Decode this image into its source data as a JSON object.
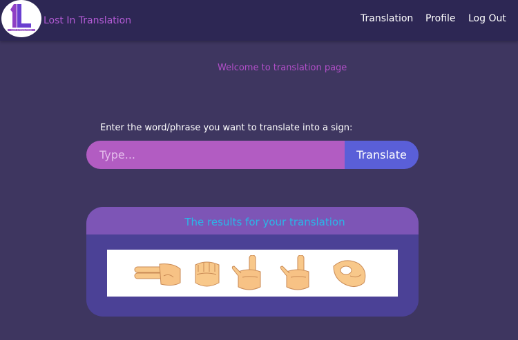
{
  "navbar": {
    "logo_alt": "LOST IN TRANSLATION",
    "title": "Lost In Translation",
    "links": [
      "Translation",
      "Profile",
      "Log Out"
    ]
  },
  "welcome": "Welcome to translation page",
  "input": {
    "label": "Enter the word/phrase you want to translate into a sign:",
    "placeholder": "Type...",
    "value": "",
    "button": "Translate"
  },
  "results": {
    "title": "The results for your translation",
    "signs": [
      "hand-sign-h-icon",
      "hand-sign-e-icon",
      "hand-sign-l-icon",
      "hand-sign-l-icon",
      "hand-sign-o-icon"
    ]
  },
  "colors": {
    "background": "#3e3660",
    "navbar": "#2d2754",
    "accent_purple": "#b25cc2",
    "button_blue": "#5a5fd8",
    "results_title": "#29b7e8"
  }
}
